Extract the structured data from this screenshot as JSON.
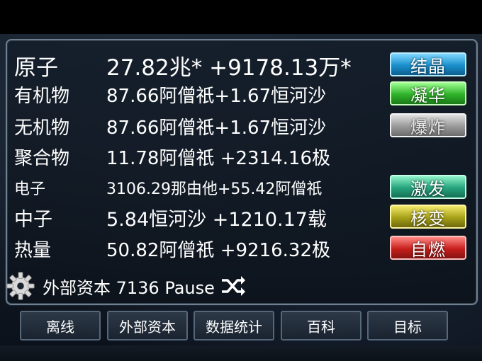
{
  "resources": [
    {
      "name": "原子",
      "value": "27.82兆* +9178.13万*"
    },
    {
      "name": "有机物",
      "value": "87.66阿僧祇+1.67恒河沙"
    },
    {
      "name": "无机物",
      "value": "87.66阿僧祇+1.67恒河沙"
    },
    {
      "name": "聚合物",
      "value": "11.78阿僧祇 +2314.16极"
    },
    {
      "name": "电子",
      "value": "3106.29那由他+55.42阿僧祇"
    },
    {
      "name": "中子",
      "value": "5.84恒河沙 +1210.17载"
    },
    {
      "name": "热量",
      "value": "50.82阿僧祇 +9216.32极"
    }
  ],
  "actions": {
    "crystallize": "结晶",
    "condense": "凝华",
    "explode": "爆炸",
    "excite": "激发",
    "fission": "核变",
    "ignite": "自燃"
  },
  "status": {
    "text": "外部资本 7136 Pause",
    "gear_icon": "gear-icon",
    "shuffle_icon": "shuffle-icon"
  },
  "tabs": [
    "离线",
    "外部资本",
    "数据统计",
    "百科",
    "目标"
  ]
}
